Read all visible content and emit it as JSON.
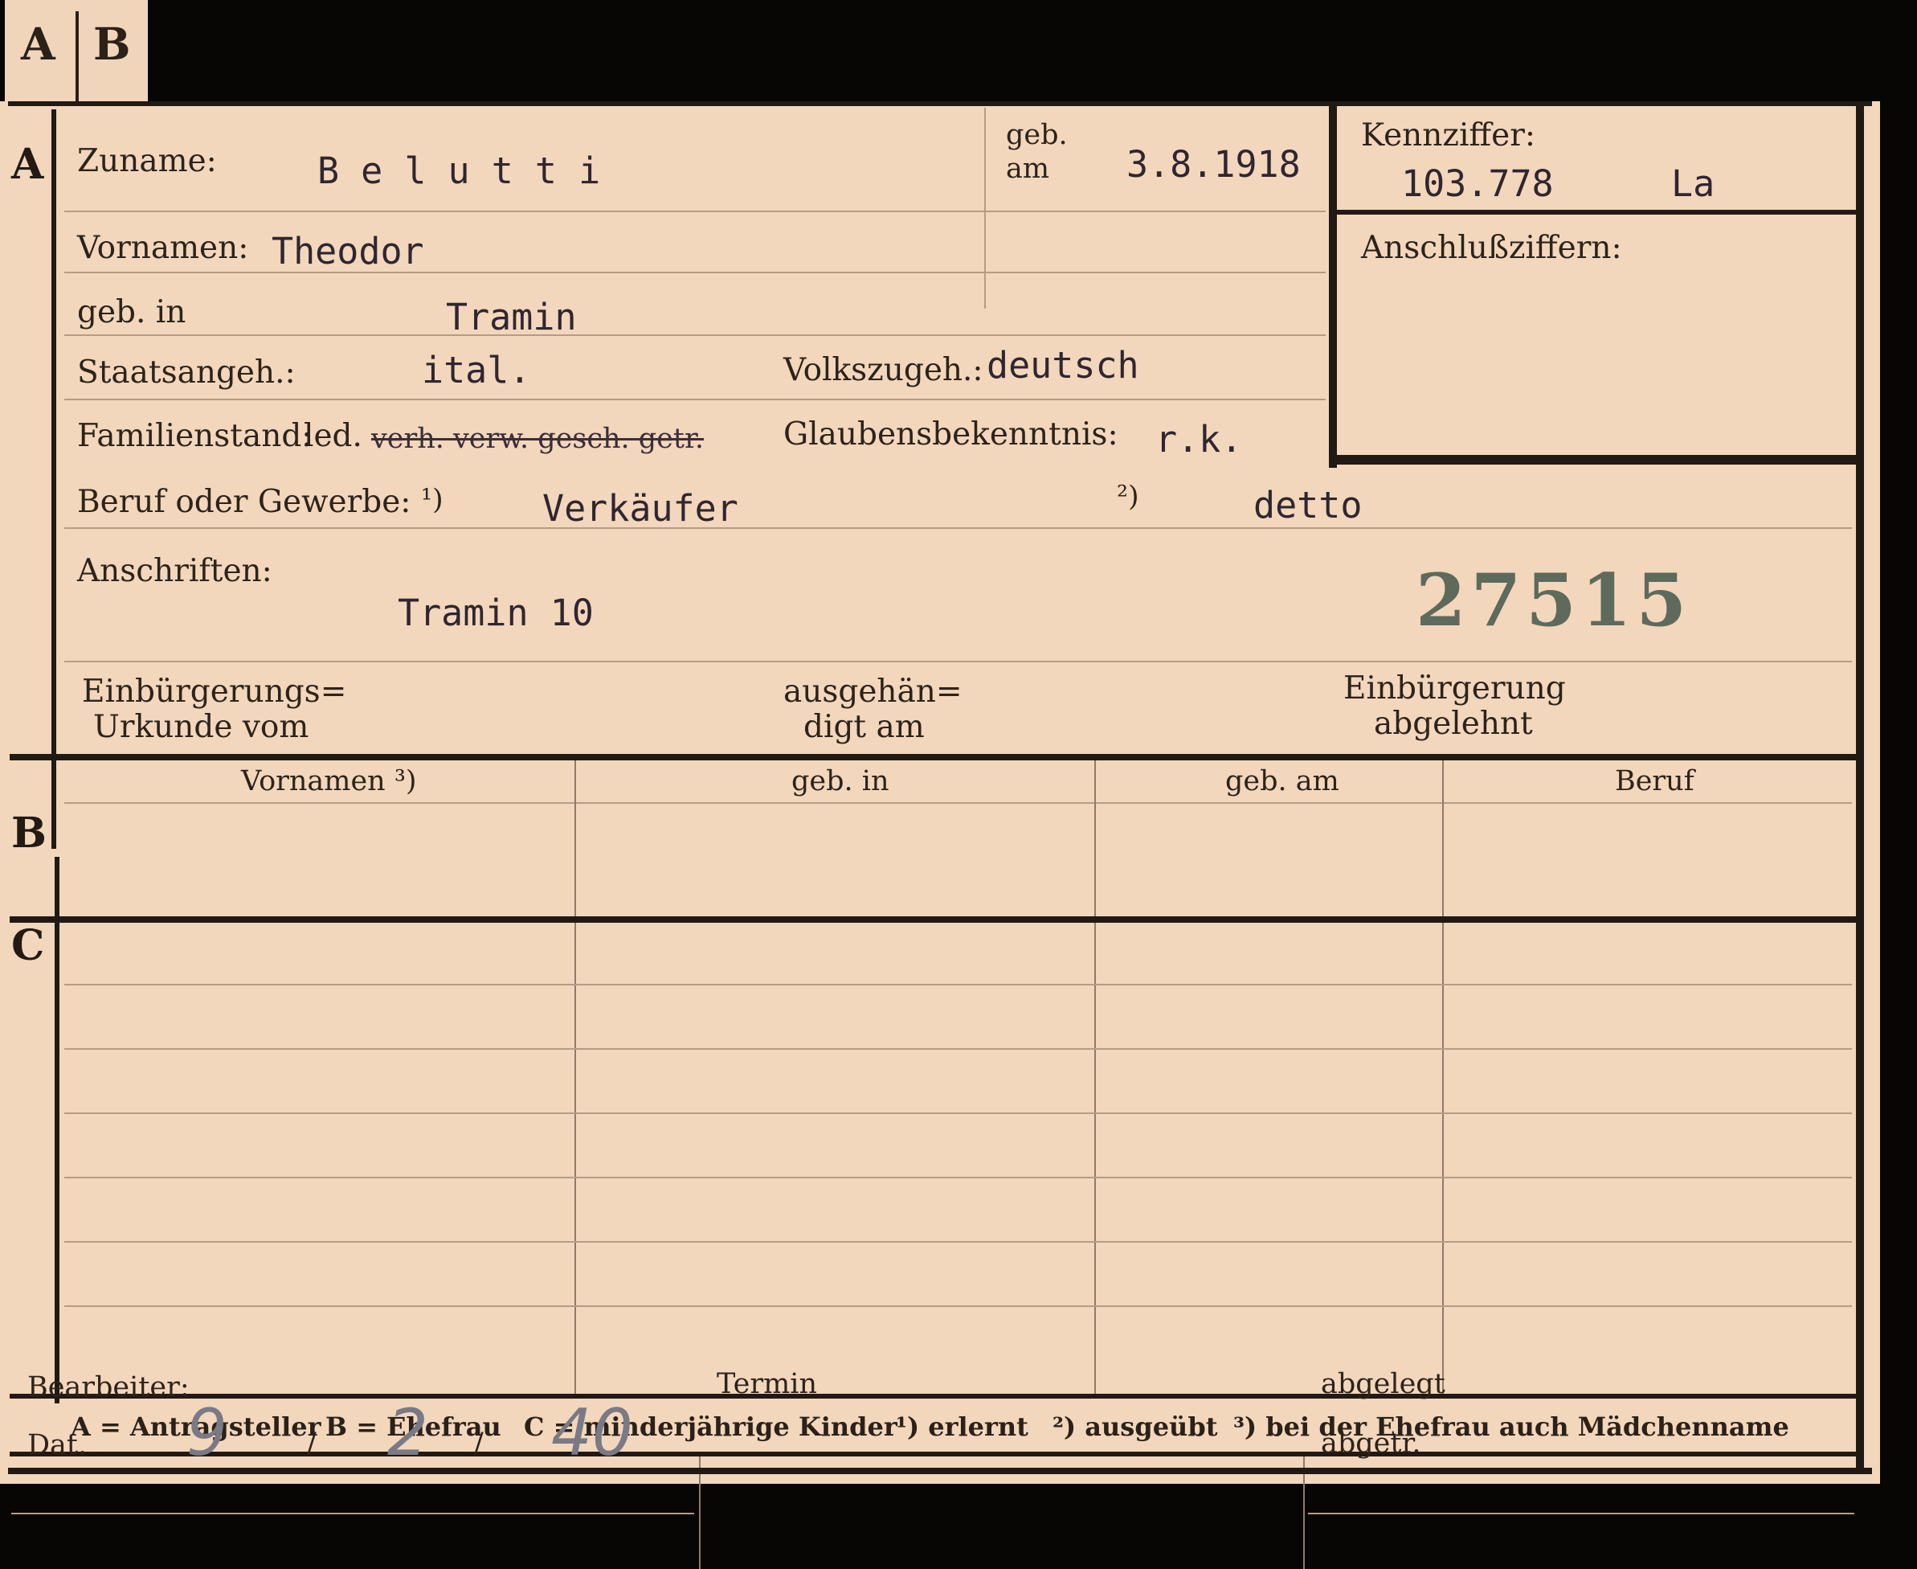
{
  "tabs": [
    "A",
    "B"
  ],
  "sections": {
    "a": "A",
    "b": "B",
    "c": "C"
  },
  "header": {
    "zuname_label": "Zuname:",
    "zuname_value": "B e l u t t i",
    "geb_am_label_1": "geb.",
    "geb_am_label_2": "am",
    "geb_am_value": "3.8.1918",
    "kennziffer_label": "Kennziffer:",
    "kennziffer_value": "103.778",
    "kennziffer_suffix": "La",
    "anschluss_label": "Anschlußziffern:"
  },
  "fields": {
    "vornamen_label": "Vornamen:",
    "vornamen_value": "Theodor",
    "geb_in_label": "geb. in",
    "geb_in_value": "Tramin",
    "staatsangeh_label": "Staatsangeh.:",
    "staatsangeh_value": "ital.",
    "volkszugeh_label": "Volkszugeh.:",
    "volkszugeh_value": "deutsch",
    "familienstand_label": "Familienstand:",
    "familienstand_kept": "led.",
    "familienstand_struck": "verh. verw. gesch. getr.",
    "glaube_label": "Glaubensbekenntnis:",
    "glaube_value": "r.k.",
    "beruf_label": "Beruf oder Gewerbe:",
    "beruf_mark1": "¹)",
    "beruf_value1": "Verkäufer",
    "beruf_mark2": "²)",
    "beruf_value2": "detto",
    "anschriften_label": "Anschriften:",
    "anschriften_value": "Tramin  10",
    "stamp_number": "27515",
    "einb_urkunde_1": "Einbürgerungs=",
    "einb_urkunde_2": "Urkunde vom",
    "ausgehaendigt_1": "ausgehän=",
    "ausgehaendigt_2": "digt am",
    "einb_abgelehnt_1": "Einbürgerung",
    "einb_abgelehnt_2": "abgelehnt"
  },
  "table": {
    "columns": [
      "Vornamen ³)",
      "geb. in",
      "geb. am",
      "Beruf"
    ]
  },
  "legend": {
    "a": "A = Antragsteller",
    "b": "B = Ehefrau",
    "c": "C = minderjährige Kinder",
    "n1": "¹) erlernt",
    "n2": "²) ausgeübt",
    "n3": "³) bei der Ehefrau auch Mädchenname"
  },
  "footer": {
    "bearbeiter_label": "Bearbeiter:",
    "dat_label": "Dat.",
    "dat_day": "9",
    "dat_month": "2",
    "dat_year": "40",
    "termin_label": "Termin",
    "abgelegt_label": "abgelegt",
    "abgetr_label": "abgetr."
  }
}
